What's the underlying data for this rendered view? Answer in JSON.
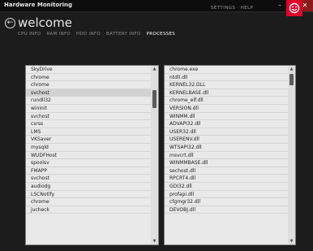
{
  "window": {
    "title": "Hardware Monitoring"
  },
  "header": {
    "heading": "welcome",
    "links": "SETTINGS · HELP",
    "logo": "brand-logo-icon"
  },
  "tabs": [
    {
      "label": "CPU INFO",
      "active": false
    },
    {
      "label": "RAM INFO",
      "active": false
    },
    {
      "label": "HDD INFO",
      "active": false
    },
    {
      "label": "BATTERY INFO",
      "active": false
    },
    {
      "label": "PROCESSES",
      "active": true
    }
  ],
  "processes": [
    "SkyDrive",
    "chrome",
    "chrome",
    "svchost",
    "rundll32",
    "wininit",
    "svchost",
    "csrss",
    "LMS",
    "VKSaver",
    "mysqld",
    "WUDFHost",
    "spoolsv",
    "FMAPP",
    "svchost",
    "audiodg",
    "LSCNotify",
    "chrome",
    "jucheck"
  ],
  "modules": [
    "chrome.exe",
    "ntdll.dll",
    "KERNEL32.DLL",
    "KERNELBASE.dll",
    "chrome_elf.dll",
    "VERSION.dll",
    "WINMM.dll",
    "ADVAPI32.dll",
    "USER32.dll",
    "USERENV.dll",
    "WTSAPI32.dll",
    "msvcrt.dll",
    "WINMMBASE.dll",
    "sechost.dll",
    "RPCRT4.dll",
    "GDI32.dll",
    "profapi.dll",
    "cfgmgr32.dll",
    "DEVOBJ.dll"
  ],
  "colors": {
    "accent": "#e2002a",
    "background": "#1c1c1c",
    "list": "#e9e9e9"
  }
}
